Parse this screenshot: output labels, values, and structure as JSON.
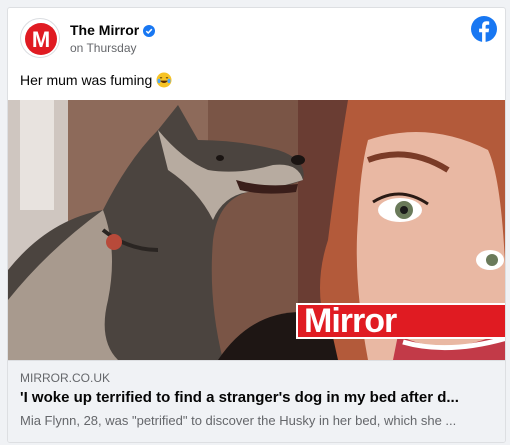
{
  "post": {
    "page_name": "The Mirror",
    "timestamp": "on Thursday",
    "text": "Her mum was fuming",
    "emoji_icon": "laughing-crying-emoji",
    "verified_icon": "verified-badge-icon",
    "platform_icon": "facebook-logo-icon"
  },
  "image": {
    "overlay_logo_text": "Mirror",
    "overlay_color": "#e01b22"
  },
  "link": {
    "domain": "MIRROR.CO.UK",
    "headline": "'I woke up terrified to find a stranger's dog in my bed after d...",
    "description": "Mia Flynn, 28, was \"petrified\" to discover the Husky in her bed, which she ..."
  },
  "colors": {
    "facebook_blue": "#1877f2",
    "mirror_red": "#e01b22"
  }
}
